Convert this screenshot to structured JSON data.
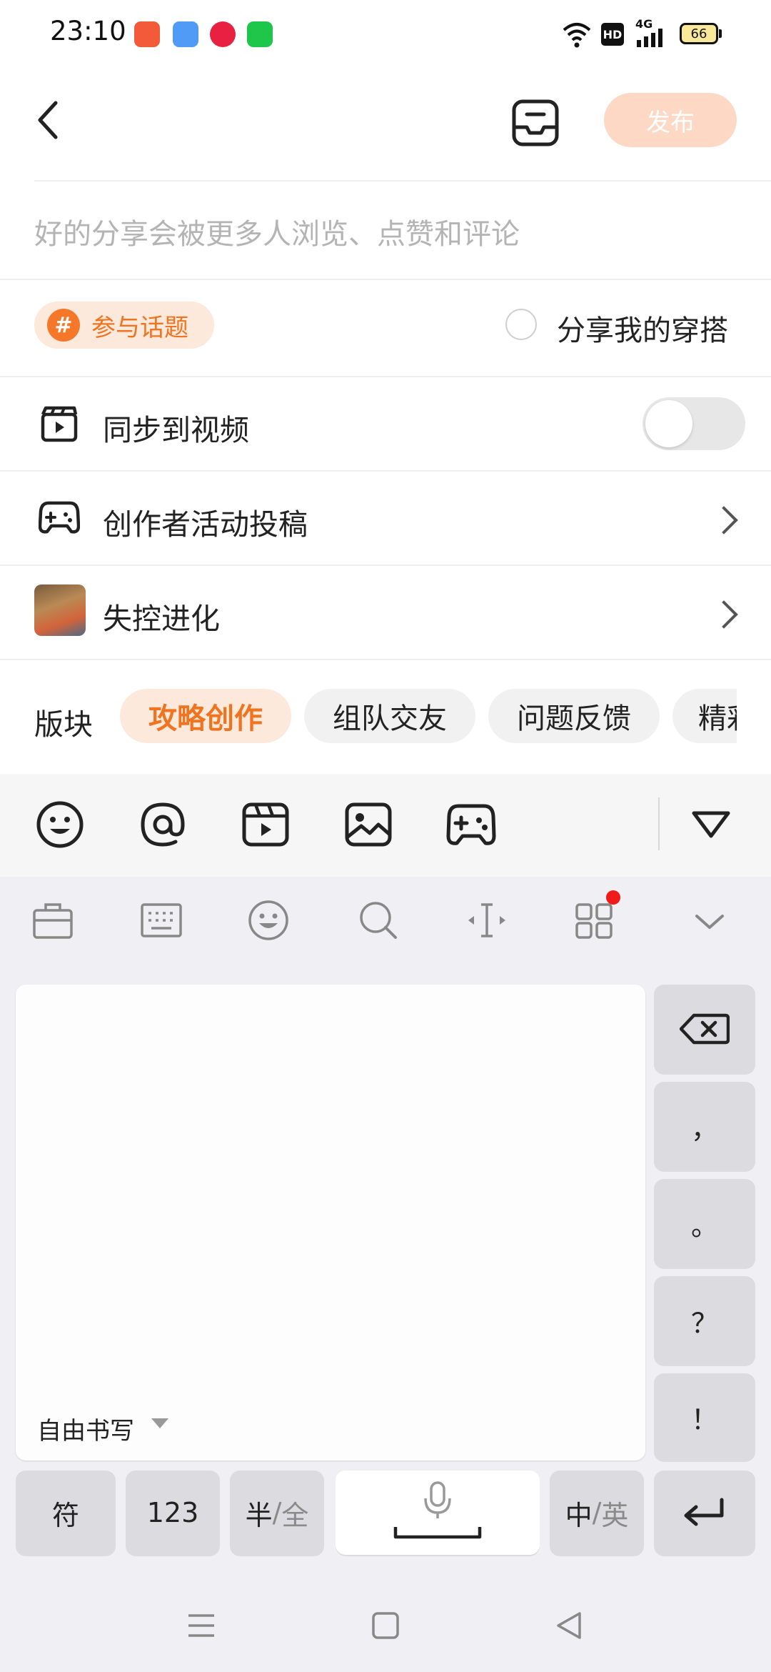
{
  "status_bar": {
    "time": "23:10",
    "battery": "66",
    "network": "4G",
    "hd_badge": "HD"
  },
  "header": {
    "publish_label": "发布"
  },
  "compose": {
    "placeholder": "好的分享会被更多人浏览、点赞和评论"
  },
  "topic": {
    "hash_symbol": "#",
    "label": "参与话题",
    "outfit_label": "分享我的穿搭"
  },
  "settings": {
    "sync_video_label": "同步到视频",
    "creator_label": "创作者活动投稿",
    "game_label": "失控进化"
  },
  "section": {
    "label": "版块",
    "chips": [
      "攻略创作",
      "组队交友",
      "问题反馈",
      "精彩"
    ]
  },
  "keyboard": {
    "handwrite_mode": "自由书写",
    "keys": {
      "comma": "，",
      "period": "。",
      "question": "？",
      "exclaim": "！",
      "symbols": "符",
      "numbers": "123",
      "half": "半",
      "full": "全",
      "chinese": "中",
      "english": "英"
    }
  },
  "colors": {
    "accent": "#f0741f",
    "accent_light": "#fde8dc",
    "publish_disabled": "#fdd9c5"
  }
}
